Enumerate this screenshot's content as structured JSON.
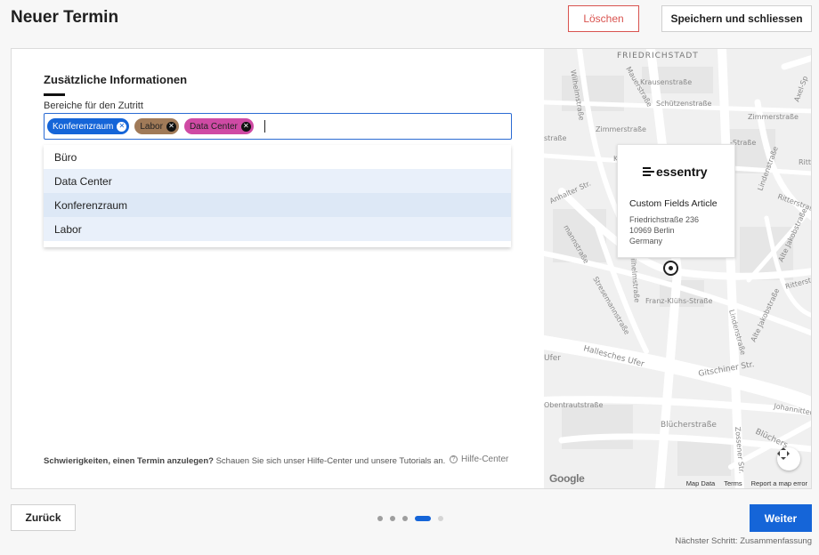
{
  "header": {
    "title": "Neuer Termin",
    "delete_label": "Löschen",
    "save_label": "Speichern und schliessen"
  },
  "form": {
    "section_title": "Zusätzliche Informationen",
    "field_label": "Bereiche für den Zutritt",
    "selected_tags": [
      {
        "label": "Konferenzraum",
        "color": "#1565d8"
      },
      {
        "label": "Labor",
        "color": "#a07a58"
      },
      {
        "label": "Data Center",
        "color": "#cf4aa4"
      }
    ],
    "options": [
      "Büro",
      "Data Center",
      "Konferenzraum",
      "Labor"
    ]
  },
  "help": {
    "bold": "Schwierigkeiten, einen Termin anzulegen?",
    "text": " Schauen Sie sich unser Hilfe-Center und unsere Tutorials an.",
    "link_label": "Hilfe-Center"
  },
  "map": {
    "card_logo": "essentry",
    "card_title": "Custom Fields Article",
    "address_line1": "Friedrichstraße 236",
    "address_line2": "10969 Berlin",
    "address_line3": "Germany",
    "google_label": "Google",
    "footer": {
      "map_data": "Map Data",
      "terms": "Terms",
      "report": "Report a map error"
    },
    "street_labels": {
      "district": "FRIEDRICHSTADT",
      "s1": "Krausenstraße",
      "s2": "Schützenstraße",
      "s3": "Zimmerstraße",
      "s4": "Zimmerstraße",
      "s5": "Kochstraße",
      "s6": "Ritterstraße",
      "s7": "Anhalter Str.",
      "s8": "Lindenstraße",
      "s9": "Alte Jakobstraße",
      "s10": "Stresemannstraße",
      "s11": "Franz-Klühs-Straße",
      "s12": "Wilhelmstraße",
      "s13": "Mauerstraße",
      "s14": "Hallesches Ufer",
      "s15": "Gitschiner Str.",
      "s16": "Obentrautstraße",
      "s17": "Johannitterstraße",
      "s18": "Blücherstraße",
      "s19": "Blüchers",
      "s20": "Zossener Str.",
      "s21": "Axel-Sp",
      "s22": "Ufer",
      "s23": "-Straße",
      "s24": "Lindenstraße",
      "s25": "Wilhelmstraße",
      "s26": "Alte Jakobstraße",
      "s27": "Ritterstraße",
      "s28": "Stresemannstraße",
      "s29": "Wilhelmstraße",
      "s30": "Lindenstraße",
      "s31": "Zossener Str.",
      "s32": "Mauerstraße",
      "s33": "mannstraße",
      "s34": "straße",
      "s35": "Ko",
      "s36": "Ritte",
      "s37": "Obentrautstraße",
      "s38": "Lindenstraße"
    }
  },
  "footer": {
    "back_label": "Zurück",
    "next_label": "Weiter",
    "next_step": "Nächster Schritt: Zusammenfassung",
    "steps_total": 5,
    "current_step": 4
  },
  "colors": {
    "accent": "#1565d8",
    "danger": "#d9534f"
  }
}
